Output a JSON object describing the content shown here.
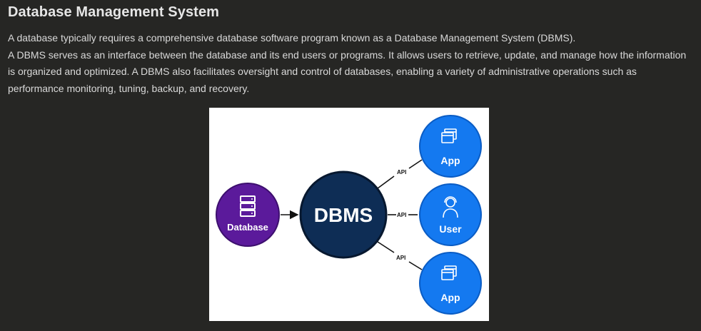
{
  "header": {
    "title": "Database Management System"
  },
  "content": {
    "paragraph_1": "A database typically requires a comprehensive database software program known as a Database Management System (DBMS).",
    "paragraph_2": "A DBMS serves as an interface between the database and its end users or programs. It allows users to retrieve, update, and manage how the information is organized and optimized. A DBMS also facilitates oversight and control of databases, enabling a variety of administrative operations such as performance monitoring, tuning, backup, and recovery."
  },
  "diagram": {
    "database_label": "Database",
    "dbms_label": "DBMS",
    "app_top_label": "App",
    "user_label": "User",
    "app_bottom_label": "App",
    "api_top_label": "API",
    "api_middle_label": "API",
    "api_bottom_label": "API",
    "colors": {
      "database": "#5b1a9b",
      "dbms": "#0e2d55",
      "client": "#1479f0",
      "background": "#ffffff"
    },
    "icons": {
      "database": "server-stack-icon",
      "app": "windows-stack-icon",
      "user": "user-headset-icon"
    }
  }
}
